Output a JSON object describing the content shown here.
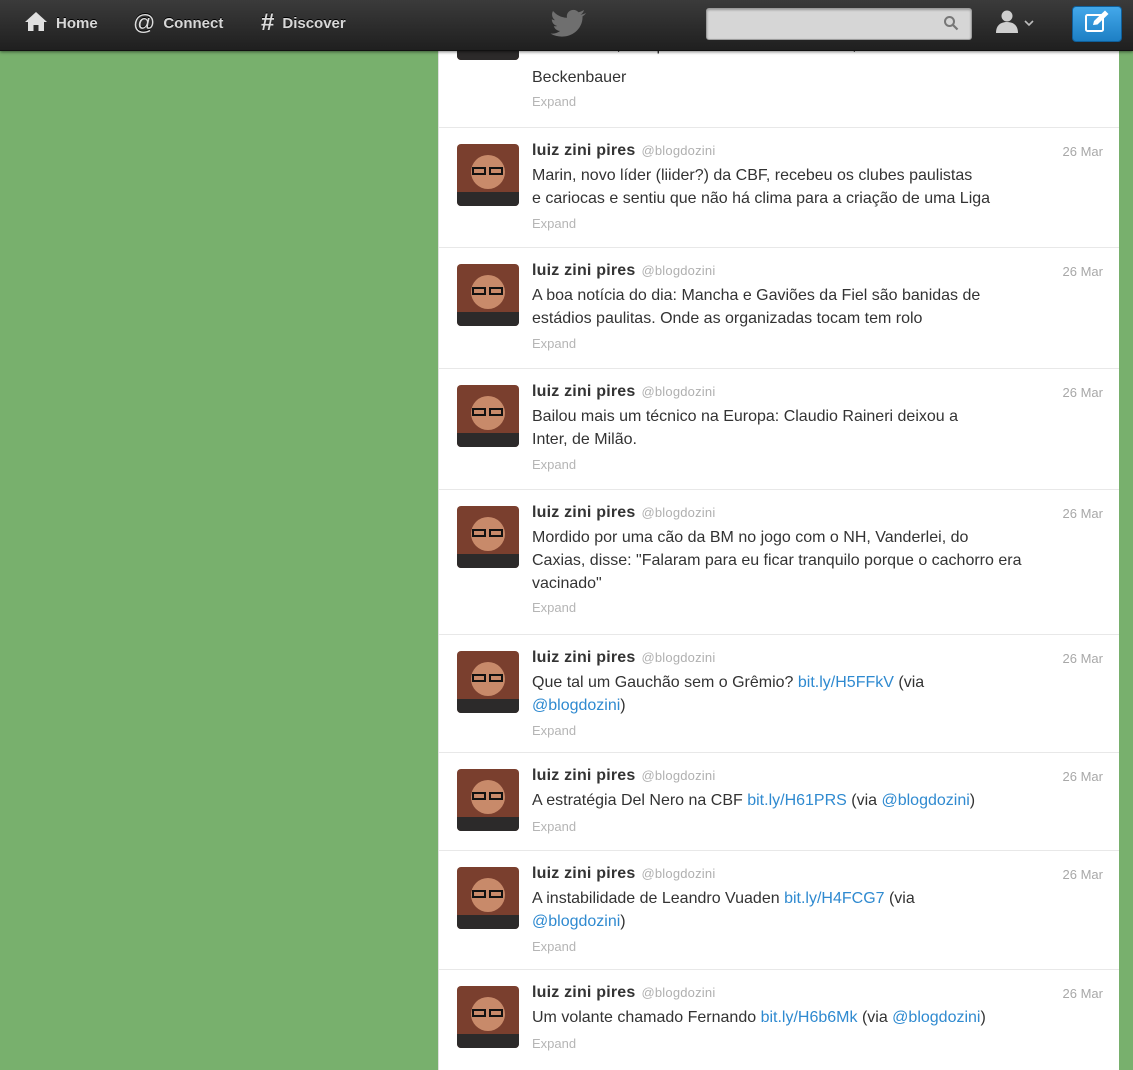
{
  "nav": {
    "home": "Home",
    "connect": "Connect",
    "discover": "Discover"
  },
  "search": {
    "value": "",
    "placeholder": ""
  },
  "colors": {
    "background": "#78b06d",
    "link": "#2f8ad0",
    "compose": "#2a8fd6"
  },
  "top_partial": {
    "line1": "Maria Marin, são-paulino e ex-atleta do clube, a Michel Platini e Franz",
    "line2": "Beckenbauer",
    "expand": "Expand"
  },
  "tweets": [
    {
      "name": "luiz zini pires",
      "handle": "@blogdozini",
      "date": "26 Mar",
      "text": [
        "Marin, novo líder (liider?) da CBF, recebeu os clubes paulistas",
        "e cariocas e sentiu que não há clima para a criação de uma Liga"
      ],
      "expand": "Expand"
    },
    {
      "name": "luiz zini pires",
      "handle": "@blogdozini",
      "date": "26 Mar",
      "text": [
        "A boa notícia do dia: Mancha e Gaviões da Fiel são banidas de",
        "estádios paulitas. Onde as organizadas tocam tem rolo"
      ],
      "expand": "Expand"
    },
    {
      "name": "luiz zini pires",
      "handle": "@blogdozini",
      "date": "26 Mar",
      "text": [
        "Bailou mais um técnico na Europa: Claudio Raineri deixou a",
        "Inter, de Milão."
      ],
      "expand": "Expand"
    },
    {
      "name": "luiz zini pires",
      "handle": "@blogdozini",
      "date": "26 Mar",
      "text": [
        "Mordido por uma cão da BM no jogo com o NH, Vanderlei, do",
        "Caxias, disse: \"Falaram para eu ficar tranquilo porque o cachorro era",
        "vacinado\""
      ],
      "expand": "Expand"
    },
    {
      "name": "luiz zini pires",
      "handle": "@blogdozini",
      "date": "26 Mar",
      "pre": "Que tal um Gauchão sem o Grêmio? ",
      "link": "bit.ly/H5FFkV",
      "post": " (via",
      "mention": "@blogdozini",
      "tail": ")",
      "expand": "Expand"
    },
    {
      "name": "luiz zini pires",
      "handle": "@blogdozini",
      "date": "26 Mar",
      "pre": "A estratégia Del Nero na CBF ",
      "link": "bit.ly/H61PRS",
      "post": " (via ",
      "mention": "@blogdozini",
      "tail": ")",
      "expand": "Expand"
    },
    {
      "name": "luiz zini pires",
      "handle": "@blogdozini",
      "date": "26 Mar",
      "pre": "A instabilidade de Leandro Vuaden ",
      "link": "bit.ly/H4FCG7",
      "post": " (via",
      "mention": "@blogdozini",
      "tail": ")",
      "expand": "Expand"
    },
    {
      "name": "luiz zini pires",
      "handle": "@blogdozini",
      "date": "26 Mar",
      "pre": "Um volante chamado Fernando ",
      "link": "bit.ly/H6b6Mk",
      "post": " (via ",
      "mention": "@blogdozini",
      "tail": ")",
      "expand": "Expand"
    }
  ]
}
